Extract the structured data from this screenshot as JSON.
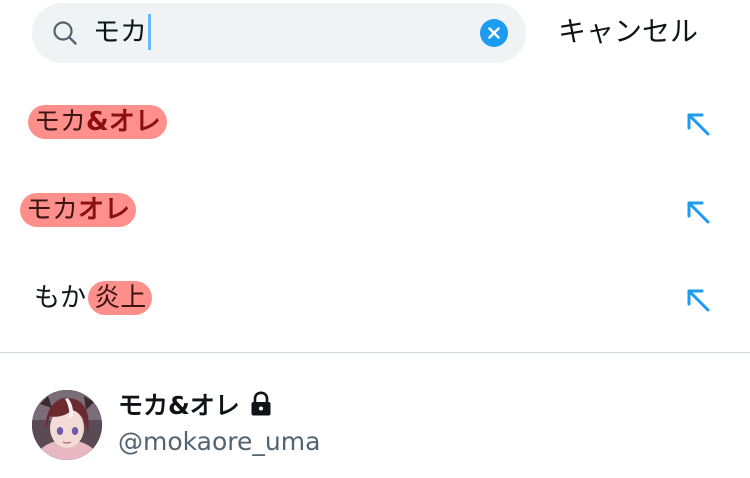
{
  "search": {
    "query": "モカ",
    "clear_icon": "close-icon",
    "cancel_label": "キャンセル"
  },
  "suggestions": [
    {
      "parts": [
        {
          "text": "モカ",
          "style": "plain"
        },
        {
          "text": "&オレ",
          "style": "bold"
        }
      ],
      "icon": "arrow-up-left-icon"
    },
    {
      "parts": [
        {
          "text": "モカ",
          "style": "plain"
        },
        {
          "text": "オレ",
          "style": "bold"
        }
      ],
      "icon": "arrow-up-left-icon"
    },
    {
      "parts": [
        {
          "text": "もか ",
          "style": "none"
        },
        {
          "text": "炎上",
          "style": "plain"
        }
      ],
      "icon": "arrow-up-left-icon"
    }
  ],
  "account": {
    "name": "モカ&オレ",
    "handle": "@mokaore_uma",
    "protected_icon": "lock-icon"
  },
  "colors": {
    "accent": "#1d9bf0",
    "highlight": "#ff8f8a",
    "search_bg": "#eff3f4",
    "handle": "#536471"
  }
}
